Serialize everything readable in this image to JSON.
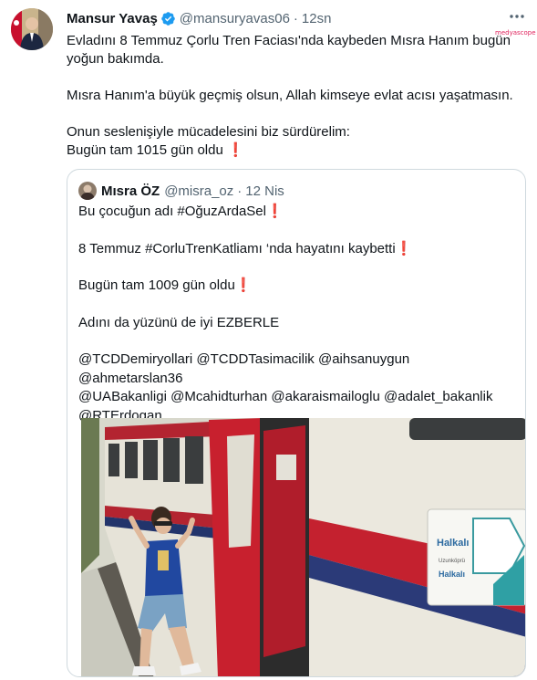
{
  "tweet": {
    "author_name": "Mansur Yavaş",
    "handle": "@mansuryavas06",
    "time": "12sn",
    "lines": [
      "Evladını 8 Temmuz Çorlu Tren Faciası'nda kaybeden Mısra Hanım bugün",
      "yoğun bakımda.",
      "Mısra Hanım'a büyük geçmiş olsun, Allah kimseye evlat acısı yaşatmasın.",
      "Onun seslenişiyle mücadelesini biz sürdürelim:",
      "Bugün tam 1015 gün oldu"
    ]
  },
  "quoted": {
    "author_name": "Mısra ÖZ",
    "handle": "@misra_oz",
    "time": "12 Nis",
    "lines": [
      "Bu çocuğun adı #OğuzArdaSel",
      "8 Temmuz #CorluTrenKatliamı ‘nda hayatını kaybetti",
      "Bugün tam 1009 gün  oldu",
      "Adını da yüzünü de iyi EZBERLE",
      "@TCDDemiryollari @TCDDTasimacilik @aihsanuygun  @ahmetarslan36",
      "@UABakanligi @Mcahidturhan @akaraismailoglu @adalet_bakanlik",
      "@RTErdogan"
    ]
  },
  "photo_sign": {
    "line1": "Halkalı",
    "line2": "Uzunköprü",
    "line3": "Halkalı"
  },
  "watermark": "medyascope",
  "colors": {
    "verified": "#1d9bf0",
    "muted": "#536471",
    "exclamation": "#d4142b",
    "border": "#cfd9de"
  },
  "icons": {
    "verified": "verified-badge-icon",
    "more": "more-options-icon",
    "exclamation": "red-exclamation-icon"
  }
}
